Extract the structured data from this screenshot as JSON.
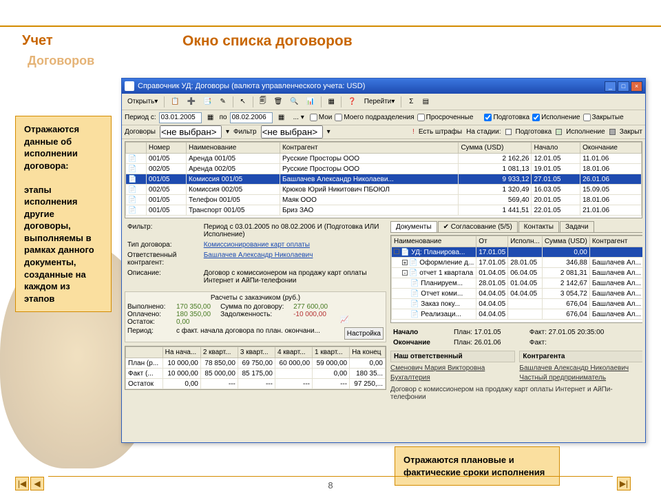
{
  "slide": {
    "brand1": "Учет",
    "brand2": "Договоров",
    "title": "Окно списка договоров",
    "callout1": "Отражаются данные об исполнении договора:\n\nэтапы исполнения другие договоры, выполняемы в рамках данного документы, созданные на каждом из этапов",
    "callout2": "Отражаются плановые и фактические сроки исполнения",
    "page": "8"
  },
  "win": {
    "title": "Справочник УД: Договоры (валюта управленческого учета: USD)",
    "open": "Открыть",
    "goto": "Перейти",
    "period_lbl": "Период с:",
    "date_from": "03.01.2005",
    "po": "по",
    "date_to": "08.02.2006",
    "chk_mine": "Мои",
    "chk_dept": "Моего подразделения",
    "chk_overdue": "Просроченные",
    "chk_prep": "Подготовка",
    "chk_exec": "Исполнение",
    "chk_closed": "Закрытые",
    "dogovory": "Договоры",
    "not_sel": "<не выбран>",
    "filter_lbl": "Фильтр",
    "legend_fine": "Есть штрафы",
    "legend_stage": "На стадии:",
    "legend_prep": "Подготовка",
    "legend_exec": "Исполнение",
    "legend_closed": "Закрыт"
  },
  "grid": {
    "cols": [
      "",
      "Номер",
      "Наименование",
      "Контрагент",
      "Сумма (USD)",
      "Начало",
      "Окончание"
    ],
    "rows": [
      {
        "num": "001/05",
        "name": "Аренда 001/05",
        "k": "Русские Просторы ООО",
        "sum": "2 162,26",
        "beg": "12.01.05",
        "end": "11.01.06"
      },
      {
        "num": "002/05",
        "name": "Аренда 002/05",
        "k": "Русские Просторы ООО",
        "sum": "1 081,13",
        "beg": "19.01.05",
        "end": "18.01.06"
      },
      {
        "num": "001/05",
        "name": "Комиссия 001/05",
        "k": "Башлачев Александр Николаеви...",
        "sum": "9 933,12",
        "beg": "27.01.05",
        "end": "26.01.06",
        "sel": true
      },
      {
        "num": "002/05",
        "name": "Комиссия 002/05",
        "k": "Крюков Юрий Никитович ПБОЮЛ",
        "sum": "1 320,49",
        "beg": "16.03.05",
        "end": "15.09.05"
      },
      {
        "num": "001/05",
        "name": "Телефон 001/05",
        "k": "Маяк ООО",
        "sum": "569,40",
        "beg": "20.01.05",
        "end": "18.01.06"
      },
      {
        "num": "001/05",
        "name": "Транспорт 001/05",
        "k": "Бриз ЗАО",
        "sum": "1 441,51",
        "beg": "22.01.05",
        "end": "21.01.06"
      }
    ]
  },
  "detail": {
    "filter_lbl": "Фильтр:",
    "filter_val": "Период с 03.01.2005 по 08.02.2006 И (Подготовка ИЛИ Исполнение)",
    "tip_lbl": "Тип договора:",
    "tip_val": "Комиссионирование карт оплаты",
    "resp_lbl": "Ответственный контрагент:",
    "resp_val": "Башлачев Александр Николаевич",
    "desc_lbl": "Описание:",
    "desc_val": "Договор с комиссионером на продажу карт оплаты Интернет и АйПи-телефонии",
    "calc_title": "Расчеты с заказчиком (руб.)",
    "vyp": "Выполнено:",
    "vyp_v": "170 350,00",
    "opl": "Оплачено:",
    "opl_v": "180 350,00",
    "ost": "Остаток:",
    "ost_v": "0,00",
    "sum": "Сумма по договору:",
    "sum_v": "277 600,00",
    "zad": "Задолженность:",
    "zad_v": "-10 000,00",
    "period_lbl": "Период:",
    "period_val": "с факт. начала договора по план. окончани...",
    "setup": "Настройка"
  },
  "mini": {
    "cols": [
      "",
      "На нача...",
      "2 кварт...",
      "3 кварт...",
      "4 кварт...",
      "1 кварт...",
      "На конец"
    ],
    "rows": [
      [
        "План (р...",
        "10 000,00",
        "78 850,00",
        "69 750,00",
        "60 000,00",
        "59 000,00",
        "0,00"
      ],
      [
        "Факт (...",
        "10 000,00",
        "85 000,00",
        "85 175,00",
        "",
        "0,00",
        "180 35..."
      ],
      [
        "Остаток",
        "0,00",
        "---",
        "---",
        "---",
        "---",
        "97 250,..."
      ]
    ]
  },
  "tabs": {
    "t1": "Документы",
    "t2": "Согласование (5/5)",
    "t3": "Контакты",
    "t4": "Задачи",
    "cols": [
      "Наименование",
      "От",
      "Исполн...",
      "Сумма (USD)",
      "Контрагент"
    ],
    "rows": [
      {
        "n": "УД: Планирова...",
        "ot": "17.01.05",
        "isp": "",
        "sum": "0,00",
        "k": "",
        "sel": true,
        "ind": 0,
        "sq": ""
      },
      {
        "n": "Оформление д...",
        "ot": "17.01.05",
        "isp": "28.01.05",
        "sum": "346,88",
        "k": "Башлачев Ал...",
        "ind": 1,
        "sq": "+"
      },
      {
        "n": "отчет 1 квартала",
        "ot": "01.04.05",
        "isp": "06.04.05",
        "sum": "2 081,31",
        "k": "Башлачев Ал...",
        "ind": 1,
        "sq": "-"
      },
      {
        "n": "Планируем...",
        "ot": "28.01.05",
        "isp": "01.04.05",
        "sum": "2 142,67",
        "k": "Башлачев Ал...",
        "ind": 2
      },
      {
        "n": "Отчет коми...",
        "ot": "04.04.05",
        "isp": "04.04.05",
        "sum": "3 054,72",
        "k": "Башлачев Ал...",
        "ind": 2
      },
      {
        "n": "Заказ поку...",
        "ot": "04.04.05",
        "isp": "",
        "sum": "676,04",
        "k": "Башлачев Ал...",
        "ind": 2
      },
      {
        "n": "Реализаци...",
        "ot": "04.04.05",
        "isp": "",
        "sum": "676,04",
        "k": "Башлачев Ал...",
        "ind": 2
      }
    ]
  },
  "foot": {
    "beg": "Начало",
    "plan": "План:",
    "beg_plan": "17.01.05",
    "fact": "Факт:",
    "beg_fact": "27.01.05 20:35:00",
    "end": "Окончание",
    "end_plan": "26.01.06",
    "end_fact": "",
    "resp_our": "Наш ответственный",
    "resp_k": "Контрагента",
    "our": "Сменович Мария Викторовна",
    "kon": "Башлачев Александр Николаевич",
    "buh": "Бухгалтерия",
    "pred": "Частный предприниматель",
    "desc": "Договор с комиссионером на продажу карт оплаты Интернет и АйПи-телефонии"
  }
}
